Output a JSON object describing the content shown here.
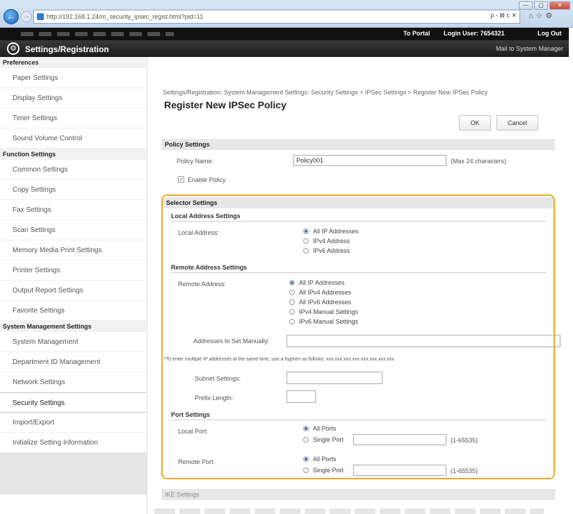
{
  "browser": {
    "url": "http://192.168.1.24/m_security_ipsec_regist.html?pid=11",
    "url_host": "192.168.1.24",
    "window_buttons": [
      "—",
      "▢",
      "✕"
    ],
    "addr_tools": "ρ - ⊠ c ✕",
    "toolbar_icons": "⌂☆⚙"
  },
  "topbar": {
    "to_portal": "To Portal",
    "login_user": "Login User:  7654321",
    "log_out": "Log Out"
  },
  "header": {
    "title": "Settings/Registration",
    "mail": "Mail to System Manager"
  },
  "sidebar": {
    "preferences_head": "Preferences",
    "preferences": [
      "Paper Settings",
      "Display Settings",
      "Timer Settings",
      "Sound Volume Control"
    ],
    "function_head": "Function Settings",
    "function": [
      "Common Settings",
      "Copy Settings",
      "Fax Settings",
      "Scan Settings",
      "Memory Media Print Settings",
      "Printer Settings",
      "Output Report Settings",
      "Favorite Settings"
    ],
    "system_head": "System Management Settings",
    "system": [
      "System Management",
      "Department ID Management",
      "Network Settings",
      "Security Settings",
      "Import/Export",
      "Initialize Setting Information"
    ]
  },
  "main": {
    "breadcrumb": "Settings/Registration: System Management Settings: Security Settings > IPSec Settings > Register New IPSec Policy",
    "title": "Register New IPSec Policy",
    "ok": "OK",
    "cancel": "Cancel",
    "policy_settings": "Policy Settings",
    "policy_name_label": "Policy Name:",
    "policy_name_value": "Policy001",
    "policy_name_hint": "(Max 24 characters)",
    "enable_policy": "Enable Policy",
    "selector_settings": "Selector Settings",
    "local_address_settings": "Local Address Settings",
    "local_address_label": "Local Address:",
    "local_options": [
      "All IP Addresses",
      "IPv4 Address",
      "IPv6 Address"
    ],
    "remote_address_settings": "Remote Address Settings",
    "remote_address_label": "Remote Address:",
    "remote_options": [
      "All IP Addresses",
      "All IPv4 Addresses",
      "All IPv6 Addresses",
      "IPv4 Manual Settings",
      "IPv6 Manual Settings"
    ],
    "addresses_manual_label": "Addresses to Set Manually:",
    "multiple_note": "*To enter multiple IP addresses at the same time, use a hyphen as follows: xxx.xxx.xxx.xxx-xxx.xxx.xxx.xxx",
    "subnet_label": "Subnet Settings:",
    "prefix_label": "Prefix Length:",
    "port_settings": "Port Settings",
    "local_port_label": "Local Port:",
    "remote_port_label": "Remote Port:",
    "all_ports": "All Ports",
    "single_port": "Single Port",
    "port_range": "(1-65535)",
    "ike_settings": "IKE Settings"
  }
}
